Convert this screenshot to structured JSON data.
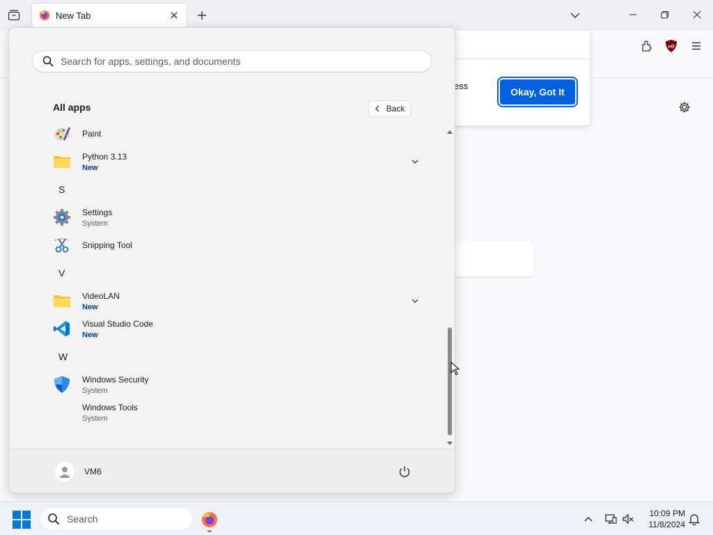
{
  "browser": {
    "tab_title": "New Tab",
    "popup_partial_text": "ess",
    "popup_button": "Okay, Got It"
  },
  "start_menu": {
    "search_placeholder": "Search for apps, settings, and documents",
    "section_title": "All apps",
    "back_label": "Back",
    "items": [
      {
        "type": "app",
        "name": "Paint",
        "sub": "",
        "icon": "paint-icon"
      },
      {
        "type": "app",
        "name": "Python 3.13",
        "sub": "New",
        "icon": "folder-icon",
        "expandable": true
      },
      {
        "type": "letter",
        "name": "S"
      },
      {
        "type": "app",
        "name": "Settings",
        "sub": "System",
        "icon": "settings-icon"
      },
      {
        "type": "app",
        "name": "Snipping Tool",
        "sub": "",
        "icon": "snipping-tool-icon"
      },
      {
        "type": "letter",
        "name": "V"
      },
      {
        "type": "app",
        "name": "VideoLAN",
        "sub": "New",
        "icon": "folder-icon",
        "expandable": true
      },
      {
        "type": "app",
        "name": "Visual Studio Code",
        "sub": "New",
        "icon": "vscode-icon"
      },
      {
        "type": "letter",
        "name": "W"
      },
      {
        "type": "app",
        "name": "Windows Security",
        "sub": "System",
        "icon": "windows-security-icon"
      },
      {
        "type": "app",
        "name": "Windows Tools",
        "sub": "System",
        "icon": "none"
      }
    ],
    "user_name": "VM6"
  },
  "taskbar": {
    "search_label": "Search",
    "time": "10:09 PM",
    "date": "11/8/2024"
  },
  "colors": {
    "accent": "#0061e0",
    "windows_blue": "#0078d4",
    "new_badge": "#003e92"
  }
}
